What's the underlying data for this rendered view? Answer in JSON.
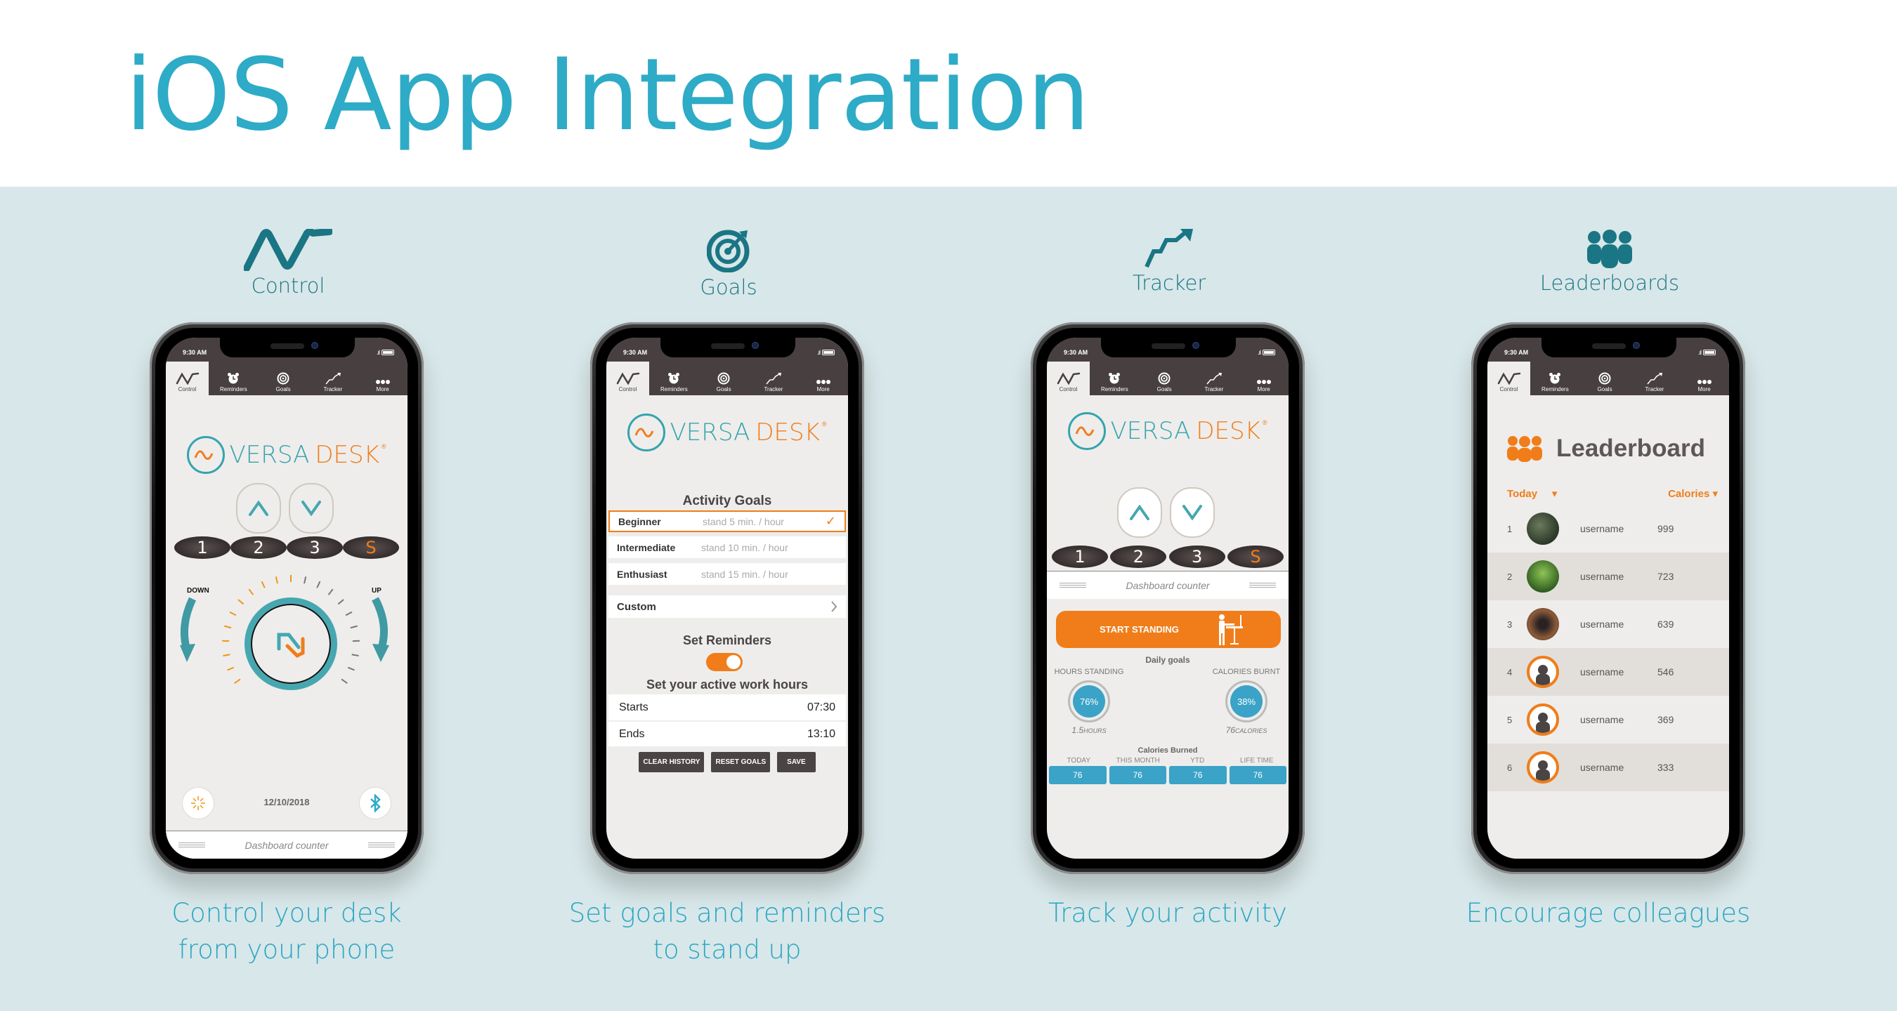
{
  "page": {
    "title": "iOS App Integration",
    "colors": {
      "accent": "#2eabc6",
      "icon_teal": "#1a7584",
      "orange": "#f07d1a",
      "band": "#d8e7e9",
      "dark": "#484040",
      "blue": "#3aa3c7"
    }
  },
  "features": [
    {
      "icon": "av-wave-icon",
      "label": "Control",
      "caption_line1": "Control your desk",
      "caption_line2": "from your phone"
    },
    {
      "icon": "target-icon",
      "label": "Goals",
      "caption_line1": "Set goals and reminders",
      "caption_line2": "to stand up"
    },
    {
      "icon": "trend-arrow-icon",
      "label": "Tracker",
      "caption_line1": "Track your activity",
      "caption_line2": ""
    },
    {
      "icon": "group-icon",
      "label": "Leaderboards",
      "caption_line1": "Encourage colleagues",
      "caption_line2": ""
    }
  ],
  "status_bar": {
    "time": "9:30 AM",
    "signal": ".ıl"
  },
  "tabs": [
    {
      "label": "Control",
      "icon": "av-wave-icon"
    },
    {
      "label": "Reminders",
      "icon": "alarm-clock-icon"
    },
    {
      "label": "Goals",
      "icon": "target-icon"
    },
    {
      "label": "Tracker",
      "icon": "trend-arrow-icon"
    },
    {
      "label": "More",
      "icon": "more-dots-icon"
    }
  ],
  "brand": {
    "word1": "VERSA",
    "word2": "DESK",
    "reg": "®"
  },
  "control": {
    "presets": [
      "1",
      "2",
      "3",
      "S"
    ],
    "down_label": "DOWN",
    "up_label": "UP",
    "date": "12/10/2018",
    "dashboard_counter": "Dashboard counter"
  },
  "goals": {
    "activity_title": "Activity Goals",
    "levels": [
      {
        "name": "Beginner",
        "desc": "stand 5 min. / hour",
        "selected": true
      },
      {
        "name": "Intermediate",
        "desc": "stand 10 min. / hour",
        "selected": false
      },
      {
        "name": "Enthusiast",
        "desc": "stand 15 min. / hour",
        "selected": false
      }
    ],
    "custom_label": "Custom",
    "reminders_title": "Set Reminders",
    "reminders_on": true,
    "hours_title": "Set your active work hours",
    "starts_label": "Starts",
    "starts_value": "07:30",
    "ends_label": "Ends",
    "ends_value": "13:10",
    "buttons": [
      "CLEAR HISTORY",
      "RESET GOALS",
      "SAVE"
    ]
  },
  "tracker": {
    "presets": [
      "1",
      "2",
      "3",
      "S"
    ],
    "dashboard_counter": "Dashboard counter",
    "start_label": "START STANDING",
    "daily_goals_title": "Daily goals",
    "hours_standing_label": "HOURS STANDING",
    "hours_standing_pct": "76%",
    "hours_value": "1.5",
    "hours_unit": "HOURS",
    "calories_burnt_label": "CALORIES BURNT",
    "calories_pct": "38%",
    "calories_value": "76",
    "calories_unit": "CALORIES",
    "calories_burned_title": "Calories Burned",
    "periods": [
      {
        "label": "TODAY",
        "value": "76"
      },
      {
        "label": "THIS MONTH",
        "value": "76"
      },
      {
        "label": "YTD",
        "value": "76"
      },
      {
        "label": "LIFE TIME",
        "value": "76"
      }
    ]
  },
  "leaderboard": {
    "title": "Leaderboard",
    "period_filter": "Today",
    "metric_filter": "Calories",
    "rows": [
      {
        "rank": "1",
        "username": "username",
        "score": "999",
        "avatar": "photo"
      },
      {
        "rank": "2",
        "username": "username",
        "score": "723",
        "avatar": "photo"
      },
      {
        "rank": "3",
        "username": "username",
        "score": "639",
        "avatar": "photo"
      },
      {
        "rank": "4",
        "username": "username",
        "score": "546",
        "avatar": "placeholder"
      },
      {
        "rank": "5",
        "username": "username",
        "score": "369",
        "avatar": "placeholder"
      },
      {
        "rank": "6",
        "username": "username",
        "score": "333",
        "avatar": "placeholder"
      }
    ]
  }
}
